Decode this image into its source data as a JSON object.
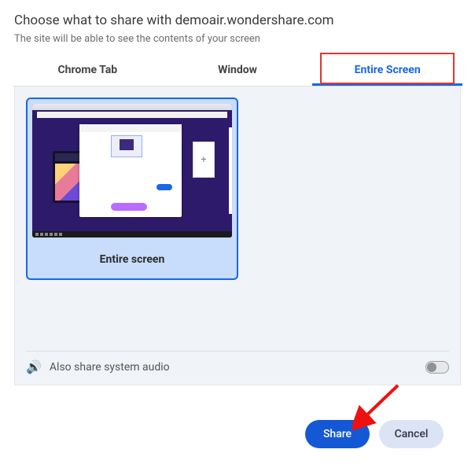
{
  "header": {
    "title": "Choose what to share with demoair.wondershare.com",
    "subtitle": "The site will be able to see the contents of your screen"
  },
  "tabs": {
    "chrome": "Chrome Tab",
    "window": "Window",
    "entire": "Entire Screen"
  },
  "card": {
    "label": "Entire screen"
  },
  "audio": {
    "label": "Also share system audio"
  },
  "footer": {
    "share": "Share",
    "cancel": "Cancel"
  }
}
